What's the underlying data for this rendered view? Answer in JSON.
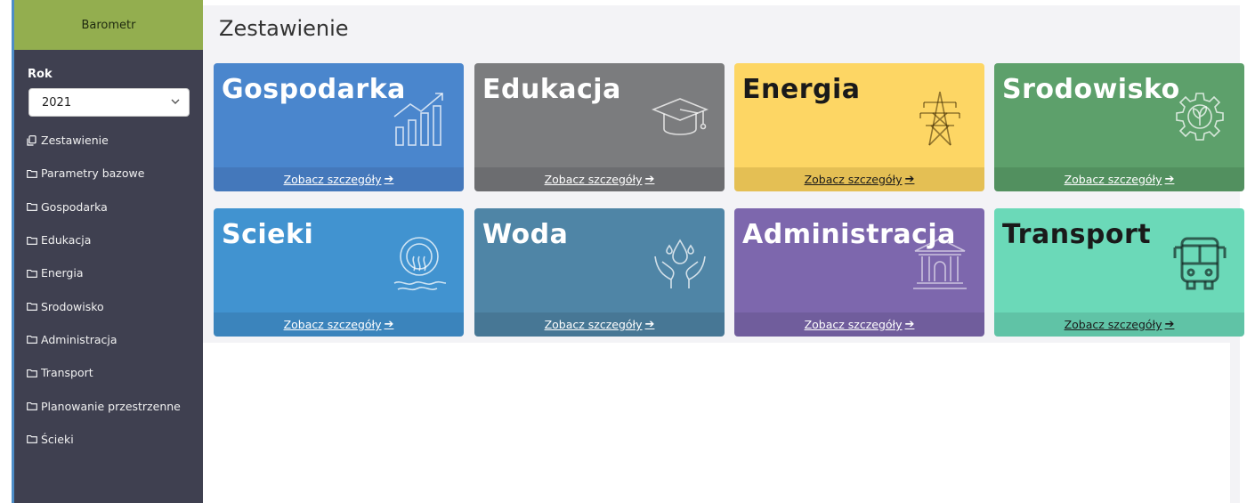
{
  "sidebar": {
    "brand": "Barometr",
    "year_label": "Rok",
    "year_value": "2021",
    "items": [
      {
        "label": "Zestawienie"
      },
      {
        "label": "Parametry bazowe"
      },
      {
        "label": "Gospodarka"
      },
      {
        "label": "Edukacja"
      },
      {
        "label": "Energia"
      },
      {
        "label": "Srodowisko"
      },
      {
        "label": "Administracja"
      },
      {
        "label": "Transport"
      },
      {
        "label": "Planowanie przestrzenne"
      },
      {
        "label": "Ścieki"
      }
    ]
  },
  "main": {
    "title": "Zestawienie",
    "cards": [
      {
        "title": "Gospodarka",
        "link": "Zobacz szczegóły",
        "icon": "chart-growth-icon",
        "color": "#4a86cd",
        "footer_color": "#4478bb"
      },
      {
        "title": "Edukacja",
        "link": "Zobacz szczegóły",
        "icon": "graduation-cap-icon",
        "color": "#7b7c7e",
        "footer_color": "#6c6d70"
      },
      {
        "title": "Energia",
        "link": "Zobacz szczegóły",
        "icon": "power-tower-icon",
        "color": "#fdd664",
        "footer_color": "#e4bf54"
      },
      {
        "title": "Srodowisko",
        "link": "Zobacz szczegóły",
        "icon": "eco-gear-icon",
        "color": "#5da06b",
        "footer_color": "#52905f"
      },
      {
        "title": "Scieki",
        "link": "Zobacz szczegóły",
        "icon": "sewage-pipe-icon",
        "color": "#4193d0",
        "footer_color": "#3b84bc"
      },
      {
        "title": "Woda",
        "link": "Zobacz szczegóły",
        "icon": "water-hands-icon",
        "color": "#4f85a6",
        "footer_color": "#477795"
      },
      {
        "title": "Administracja",
        "link": "Zobacz szczegóły",
        "icon": "government-building-icon",
        "color": "#7d67ad",
        "footer_color": "#705d9c"
      },
      {
        "title": "Transport",
        "link": "Zobacz szczegóły",
        "icon": "bus-icon",
        "color": "#6bd9b8",
        "footer_color": "#60c3a6"
      }
    ]
  }
}
